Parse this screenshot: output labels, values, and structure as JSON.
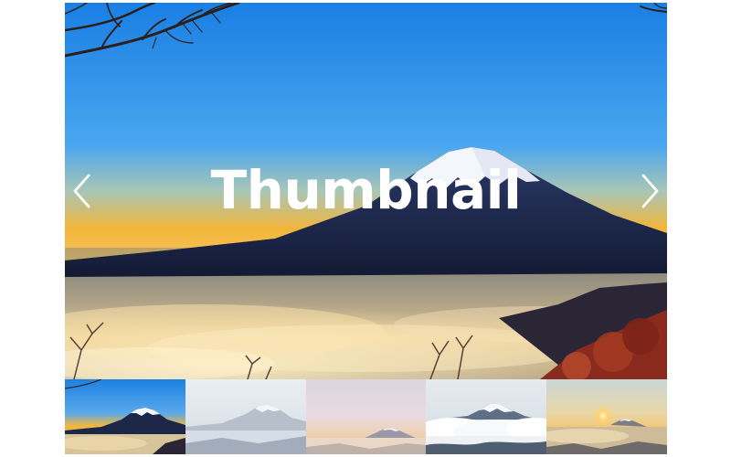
{
  "slider": {
    "title": "Thumbnail",
    "active_index": 0,
    "prev_icon": "chevron-left-icon",
    "next_icon": "chevron-right-icon"
  },
  "thumbnails": [
    {
      "scene": "mountain-sunrise-blue-sky",
      "active": true
    },
    {
      "scene": "mountain-pale-haze",
      "active": false
    },
    {
      "scene": "mountain-pink-dusk",
      "active": false
    },
    {
      "scene": "mountain-clouds-white",
      "active": false
    },
    {
      "scene": "mountain-sunrise-golden",
      "active": false
    }
  ],
  "colors": {
    "sky_top": "#1f86e6",
    "sky_horizon": "#f3b43a",
    "mountain": "#1e2a4f",
    "snow": "#f4f6fb",
    "arrow": "#ffffff",
    "title": "#ffffff"
  }
}
